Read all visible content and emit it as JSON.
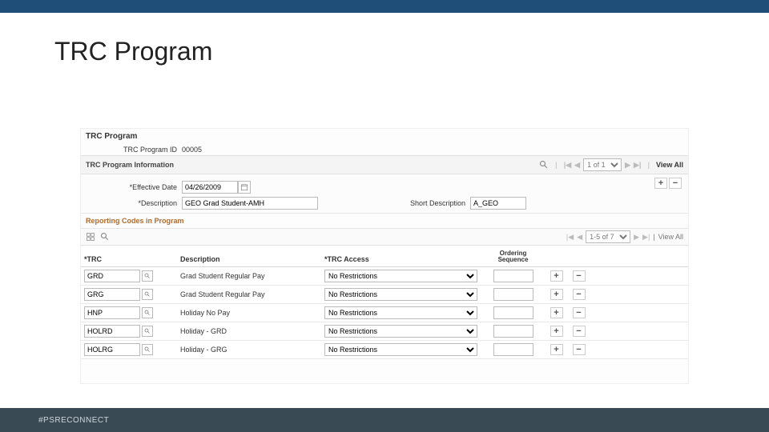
{
  "slide": {
    "title": "TRC Program",
    "footer": "#PSRECONNECT"
  },
  "page": {
    "title": "TRC Program",
    "program_id_label": "TRC Program ID",
    "program_id_value": "00005"
  },
  "info_section": {
    "title": "TRC Program Information",
    "pager_options": [
      "1 of 1"
    ],
    "pager_selected": "1 of 1",
    "view_all": "View All",
    "effective_date_label": "Effective Date",
    "effective_date_value": "04/26/2009",
    "description_label": "Description",
    "description_value": "GEO Grad Student-AMH",
    "short_description_label": "Short Description",
    "short_description_value": "A_GEO"
  },
  "codes_section": {
    "title": "Reporting Codes in Program",
    "pager_options": [
      "1-5 of 7"
    ],
    "pager_selected": "1-5 of 7",
    "view_all": "View All",
    "headers": {
      "trc": "TRC",
      "description": "Description",
      "trc_access": "TRC Access",
      "ordering_sequence": "Ordering Sequence"
    },
    "access_options": [
      "No Restrictions"
    ],
    "rows": [
      {
        "trc": "GRD",
        "description": "Grad Student Regular Pay",
        "access": "No Restrictions",
        "sequence": ""
      },
      {
        "trc": "GRG",
        "description": "Grad Student Regular Pay",
        "access": "No Restrictions",
        "sequence": ""
      },
      {
        "trc": "HNP",
        "description": "Holiday No Pay",
        "access": "No Restrictions",
        "sequence": ""
      },
      {
        "trc": "HOLRD",
        "description": "Holiday - GRD",
        "access": "No Restrictions",
        "sequence": ""
      },
      {
        "trc": "HOLRG",
        "description": "Holiday - GRG",
        "access": "No Restrictions",
        "sequence": ""
      }
    ]
  }
}
